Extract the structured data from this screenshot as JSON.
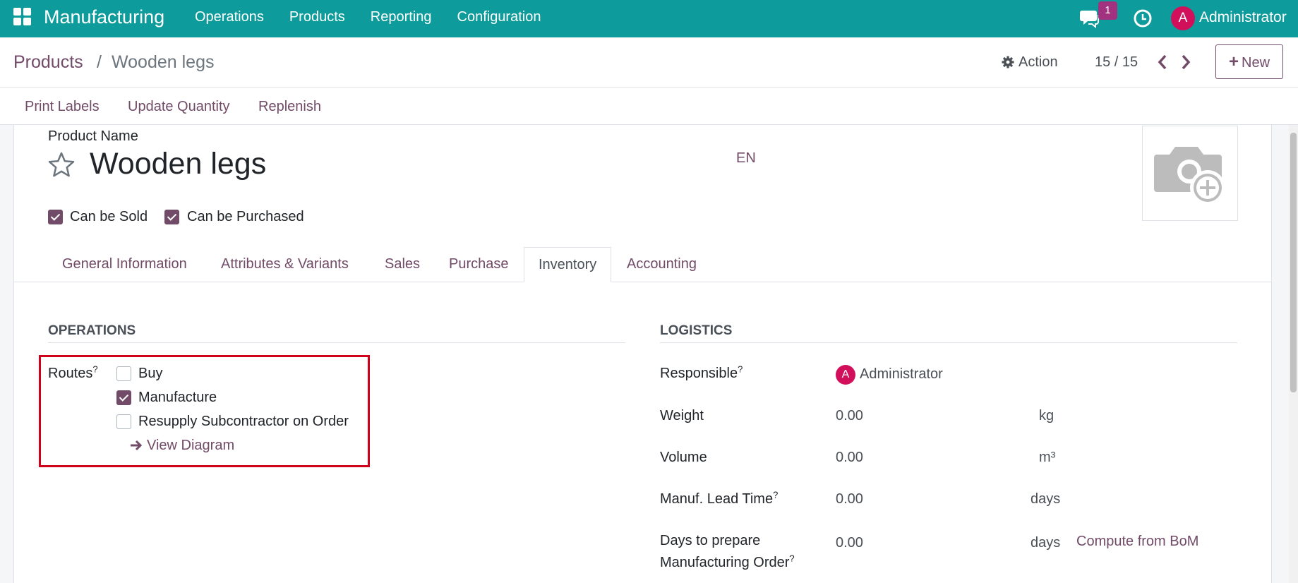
{
  "navbar": {
    "app_title": "Manufacturing",
    "menu": [
      "Operations",
      "Products",
      "Reporting",
      "Configuration"
    ],
    "notification_count": "1",
    "user_initial": "A",
    "user_name": "Administrator",
    "accent_color": "#0e9b9b"
  },
  "breadcrumb": {
    "parent": "Products",
    "separator": "/",
    "current": "Wooden legs"
  },
  "control_panel": {
    "action_label": "Action",
    "pager": "15 / 15",
    "new_label": "New"
  },
  "statusbar": {
    "buttons": [
      "Print Labels",
      "Update Quantity",
      "Replenish"
    ]
  },
  "product": {
    "name_label": "Product Name",
    "name": "Wooden legs",
    "language": "EN",
    "can_be_sold_label": "Can be Sold",
    "can_be_sold": true,
    "can_be_purchased_label": "Can be Purchased",
    "can_be_purchased": true
  },
  "tabs": [
    {
      "label": "General Information",
      "active": false
    },
    {
      "label": "Attributes & Variants",
      "active": false
    },
    {
      "label": "Sales",
      "active": false
    },
    {
      "label": "Purchase",
      "active": false
    },
    {
      "label": "Inventory",
      "active": true
    },
    {
      "label": "Accounting",
      "active": false
    }
  ],
  "operations": {
    "title": "OPERATIONS",
    "routes_label": "Routes",
    "tooltip_mark": "?",
    "routes": [
      {
        "label": "Buy",
        "checked": false
      },
      {
        "label": "Manufacture",
        "checked": true
      },
      {
        "label": "Resupply Subcontractor on Order",
        "checked": false
      }
    ],
    "view_diagram": "View Diagram"
  },
  "logistics": {
    "title": "LOGISTICS",
    "responsible_label": "Responsible",
    "responsible_initial": "A",
    "responsible": "Administrator",
    "weight_label": "Weight",
    "weight": "0.00",
    "weight_unit": "kg",
    "volume_label": "Volume",
    "volume": "0.00",
    "volume_unit": "m³",
    "lead_time_label": "Manuf. Lead Time",
    "lead_time": "0.00",
    "lead_time_unit": "days",
    "days_prepare_label_1": "Days to prepare",
    "days_prepare_label_2": "Manufacturing Order",
    "days_prepare": "0.00",
    "days_prepare_unit": "days",
    "compute_link": "Compute from BoM"
  },
  "colors": {
    "brand": "#714b67",
    "highlight": "#d0021b",
    "avatar": "#d10f5b"
  }
}
